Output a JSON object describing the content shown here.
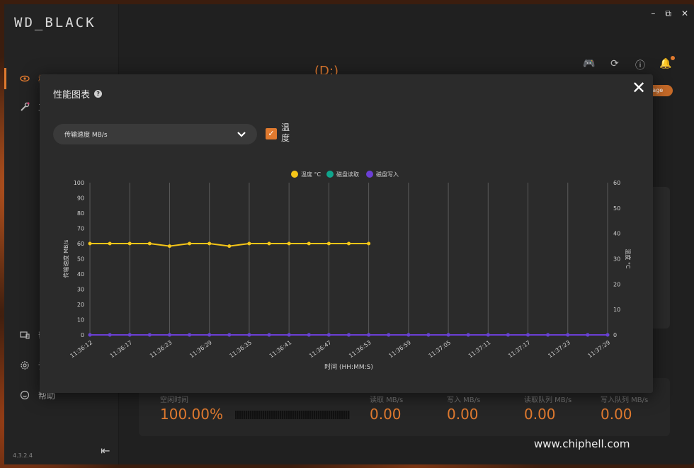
{
  "app": {
    "logo": "WD_BLACK",
    "version": "4.3.2.4",
    "drive_label": "(D:)",
    "pill_label": "rage",
    "nav": [
      {
        "label": "概览",
        "icon": "eye-icon"
      },
      {
        "label": "工",
        "icon": "wrench-icon"
      }
    ],
    "nav_bottom": [
      {
        "label": "帮",
        "icon": "devices-icon"
      },
      {
        "label": "设",
        "icon": "gear-icon"
      },
      {
        "label": "帮助",
        "icon": "smile-icon"
      }
    ],
    "collapse_label": "⇤",
    "window_controls": {
      "minimize": "–",
      "maximize": "⧉",
      "close": "✕"
    },
    "top_icons": [
      "gamepad-icon",
      "folder-icon",
      "info-icon",
      "bell-icon"
    ]
  },
  "stats": {
    "percent": "100.00%",
    "percent_label": "空闲时间",
    "read_label": "读取 MB/s",
    "read": "0.00",
    "write_label": "写入 MB/s",
    "write": "0.00",
    "read_q_label": "读取队列 MB/s",
    "read_q": "0.00",
    "write_q_label": "写入队列 MB/s",
    "write_q": "0.00"
  },
  "modal": {
    "title": "性能图表",
    "close_label": "✕",
    "select_value": "传输速度 MB/s",
    "temp_checkbox_label": "温度",
    "temp_checked": true
  },
  "chart_data": {
    "type": "line",
    "legend": [
      "温度 °C",
      "磁盘读取",
      "磁盘写入"
    ],
    "legend_colors": [
      "#f5c518",
      "#0fa58c",
      "#6b3fd4"
    ],
    "xlabel": "时间 (HH:MM:S)",
    "ylabel": "传输速度 MB/s",
    "ylabel_right": "温度 °C",
    "ylim": [
      0,
      100
    ],
    "ylim_right": [
      0,
      60
    ],
    "yticks": [
      0,
      10,
      20,
      30,
      40,
      50,
      60,
      70,
      80,
      90,
      100
    ],
    "yticks_right": [
      0,
      10,
      20,
      30,
      40,
      50,
      60
    ],
    "x_tick_labels": [
      "11:36:12",
      "11:36:17",
      "11:36:23",
      "11:36:29",
      "11:36:35",
      "11:36:41",
      "11:36:47",
      "11:36:53",
      "11:36:59",
      "11:37:05",
      "11:37:11",
      "11:37:17",
      "11:37:23",
      "11:37:29"
    ],
    "n_points": 27,
    "series": [
      {
        "name": "温度 °C",
        "axis": "right",
        "values": [
          36,
          36,
          36,
          36,
          35,
          36,
          36,
          35,
          36,
          36,
          36,
          36,
          36,
          36,
          36
        ]
      },
      {
        "name": "磁盘读取",
        "axis": "left",
        "values": [
          0,
          0,
          0,
          0,
          0,
          0,
          0,
          0,
          0,
          0,
          0,
          0,
          0,
          0,
          0,
          0,
          0,
          0,
          0,
          0,
          0,
          0,
          0,
          0,
          0,
          0,
          0
        ]
      },
      {
        "name": "磁盘写入",
        "axis": "left",
        "values": [
          0,
          0,
          0,
          0,
          0,
          0,
          0,
          0,
          0,
          0,
          0,
          0,
          0,
          0,
          0,
          0,
          0,
          0,
          0,
          0,
          0,
          0,
          0,
          0,
          0,
          0,
          0
        ]
      }
    ]
  },
  "watermark": {
    "text": "www.chiphell.com",
    "logo": "chip\nhell"
  }
}
